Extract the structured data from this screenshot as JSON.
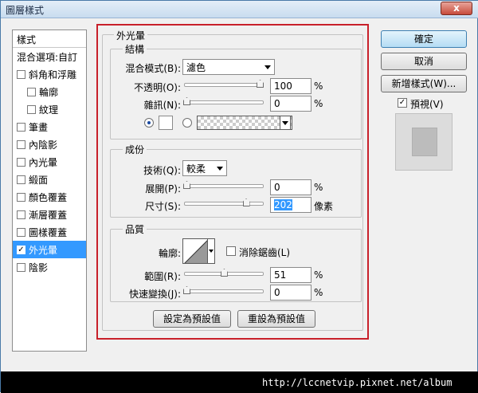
{
  "window": {
    "title": "圖層樣式",
    "close": "x"
  },
  "sidebar": {
    "header": "樣式",
    "items": [
      {
        "label": "混合選項:自訂",
        "checkbox": false,
        "sub": false,
        "checked": false
      },
      {
        "label": "斜角和浮雕",
        "checkbox": true,
        "sub": false,
        "checked": false
      },
      {
        "label": "輪廓",
        "checkbox": true,
        "sub": true,
        "checked": false
      },
      {
        "label": "紋理",
        "checkbox": true,
        "sub": true,
        "checked": false
      },
      {
        "label": "筆畫",
        "checkbox": true,
        "sub": false,
        "checked": false
      },
      {
        "label": "內陰影",
        "checkbox": true,
        "sub": false,
        "checked": false
      },
      {
        "label": "內光暈",
        "checkbox": true,
        "sub": false,
        "checked": false
      },
      {
        "label": "緞面",
        "checkbox": true,
        "sub": false,
        "checked": false
      },
      {
        "label": "顏色覆蓋",
        "checkbox": true,
        "sub": false,
        "checked": false
      },
      {
        "label": "漸層覆蓋",
        "checkbox": true,
        "sub": false,
        "checked": false
      },
      {
        "label": "圖樣覆蓋",
        "checkbox": true,
        "sub": false,
        "checked": false
      },
      {
        "label": "外光暈",
        "checkbox": true,
        "sub": false,
        "checked": true,
        "selected": true
      },
      {
        "label": "陰影",
        "checkbox": true,
        "sub": false,
        "checked": false
      }
    ]
  },
  "outer_glow": {
    "title": "外光暈",
    "structure": {
      "title": "結構",
      "blend_mode_label": "混合模式(B):",
      "blend_mode_value": "濾色",
      "opacity_label": "不透明(O):",
      "opacity_value": "100",
      "opacity_unit": "%",
      "opacity_level": 1.0,
      "noise_label": "雜訊(N):",
      "noise_value": "0",
      "noise_unit": "%",
      "noise_level": 0.0
    },
    "elements": {
      "title": "成份",
      "technique_label": "技術(Q):",
      "technique_value": "較柔",
      "spread_label": "展開(P):",
      "spread_value": "0",
      "spread_unit": "%",
      "spread_level": 0.0,
      "size_label": "尺寸(S):",
      "size_value": "202",
      "size_unit": "像素",
      "size_level": 0.81
    },
    "quality": {
      "title": "品質",
      "contour_label": "輪廓:",
      "anti_alias_label": "消除鋸齒(L)",
      "anti_alias_checked": false,
      "range_label": "範圍(R):",
      "range_value": "51",
      "range_unit": "%",
      "range_level": 0.51,
      "jitter_label": "快速變換(J):",
      "jitter_value": "0",
      "jitter_unit": "%",
      "jitter_level": 0.0
    },
    "make_default_label": "設定為預設值",
    "reset_default_label": "重設為預設值"
  },
  "actions": {
    "ok_label": "確定",
    "cancel_label": "取消",
    "new_style_label": "新增樣式(W)...",
    "preview_label": "預視(V)",
    "preview_checked": true
  },
  "watermark": "http://lccnetvip.pixnet.net/album",
  "colors": {
    "highlight": "#c8202a",
    "selection": "#3399ff"
  }
}
